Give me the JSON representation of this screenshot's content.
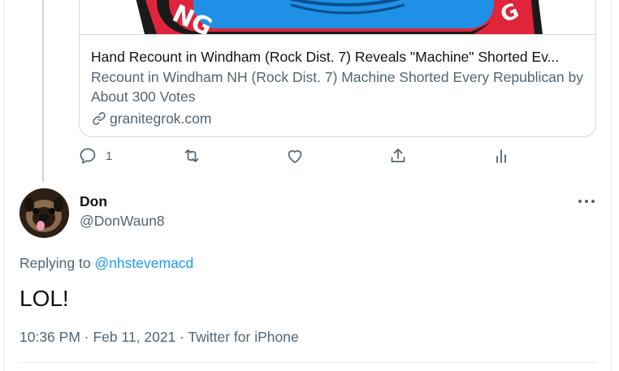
{
  "link_card": {
    "title": "Hand Recount in Windham (Rock Dist. 7) Reveals \"Machine\" Shorted Ev...",
    "description": "Recount in Windham NH (Rock Dist. 7) Machine Shorted Every Republican by About 300 Votes",
    "domain": "granitegrok.com",
    "image_letters": "NG",
    "image_letters_right": "G"
  },
  "previous_tweet_actions": {
    "reply_count": "1"
  },
  "tweet": {
    "author_name": "Don",
    "author_handle": "@DonWaun8",
    "replying_prefix": "Replying to",
    "replying_to": "@nhstevemacd",
    "body": "LOL!",
    "meta": "10:36 PM · Feb 11, 2021 · Twitter for iPhone"
  },
  "colors": {
    "link_blue": "#1d9bf0",
    "secondary_text": "#536471",
    "border": "#cfd9de",
    "image_blue": "#1e90e6",
    "image_red": "#e0253a"
  },
  "icons": [
    "reply-icon",
    "retweet-icon",
    "like-icon",
    "share-icon",
    "analytics-icon",
    "link-icon",
    "more-icon"
  ]
}
